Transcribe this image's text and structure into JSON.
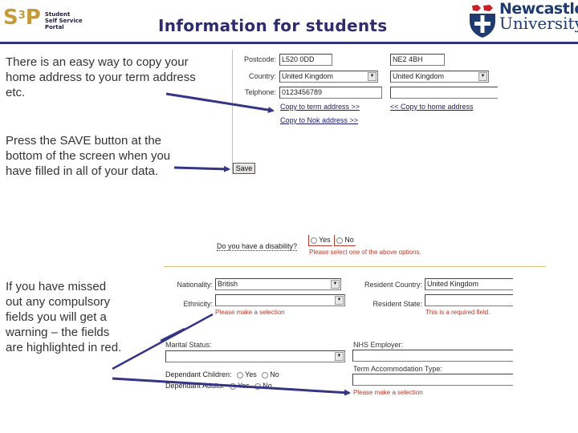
{
  "header": {
    "s3p_logo": {
      "mark": "S",
      "sup": "3",
      "mark_end": "P",
      "lines": [
        "Student",
        "Self Service",
        "Portal"
      ]
    },
    "title": "Information for students",
    "university_logo": {
      "line1": "Newcastle",
      "line2": "University"
    },
    "rule_color": "#353575"
  },
  "notes": {
    "copy_address": "There is an easy way to copy your home address to your term address etc.",
    "save_button": "Press the SAVE button at the bottom of the screen when you have filled in all of your data.",
    "missed_fields": "If you have missed out any compulsory fields you will get a warning – the fields are highlighted in red."
  },
  "address_form": {
    "postcode_label": "Postcode:",
    "postcode_home": "L520 0DD",
    "postcode_term": "NE2 4BH",
    "country_label": "Country:",
    "country_home": "United Kingdom",
    "country_term": "United Kingdom",
    "telephone_label": "Telphone:",
    "telephone_home": "0123456789",
    "telephone_term": "",
    "copy_to_term": "Copy to term address >>",
    "copy_to_home": "<< Copy to home address",
    "copy_to_nok": "Copy to Nok address >>"
  },
  "save_button": {
    "label": "Save"
  },
  "disability": {
    "question": "Do you have a disability?",
    "options": [
      "Yes",
      "No"
    ],
    "error": "Please select one of the above options."
  },
  "personal_form": {
    "nationality_label": "Nationality:",
    "nationality_value": "British",
    "ethnicity_label": "Ethnicity:",
    "ethnicity_value": "",
    "ethnicity_error": "Please make a selection",
    "resident_country_label": "Resident Country:",
    "resident_country_value": "United Kingdom",
    "resident_state_label": "Resident State:",
    "resident_state_value": "",
    "resident_state_error": "This is a required field.",
    "marital_status_label": "Marital Status:",
    "marital_status_value": "",
    "nhs_employer_label": "NHS Employer:",
    "nhs_employer_value": "",
    "dependant_children_label": "Dependant Children:",
    "dependant_adults_label": "Dependant Adults:",
    "radio_yes": "Yes",
    "radio_no": "No",
    "term_accommodation_label": "Term Accommodation Type:",
    "term_accommodation_value": "",
    "term_accommodation_error": "Please make a selection"
  },
  "colors": {
    "title": "#2d2d6e",
    "arrow": "#353585",
    "error": "#b33a2a",
    "gold_rule": "#d9c07a",
    "s3p_gold": "#c59a3d"
  }
}
